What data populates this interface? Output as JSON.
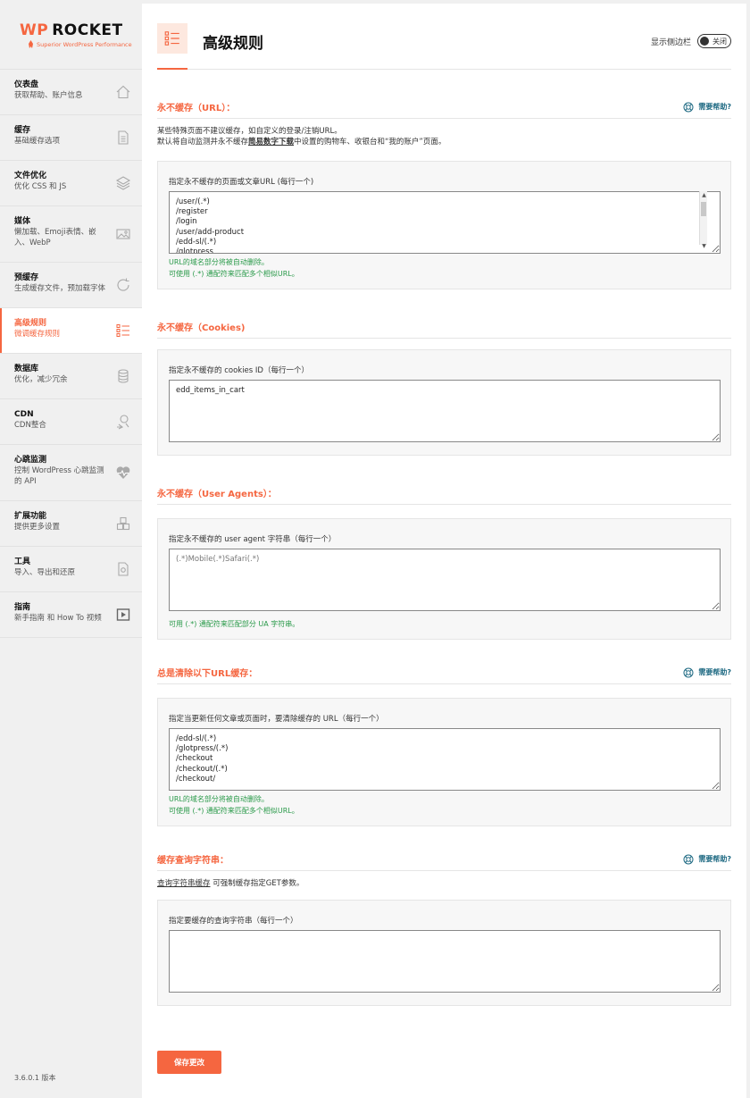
{
  "logo": {
    "brand_wp": "WP",
    "brand_rocket": "ROCKET",
    "tagline": "Superior WordPress Performance"
  },
  "sidebar": {
    "items": [
      {
        "title": "仪表盘",
        "desc": "获取帮助、账户信息",
        "icon": "home-icon"
      },
      {
        "title": "缓存",
        "desc": "基础缓存选项",
        "icon": "document-icon"
      },
      {
        "title": "文件优化",
        "desc": "优化 CSS 和 JS",
        "icon": "layers-icon"
      },
      {
        "title": "媒体",
        "desc": "懒加载、Emoji表情、嵌入、WebP",
        "icon": "image-icon"
      },
      {
        "title": "预缓存",
        "desc": "生成缓存文件，预加载字体",
        "icon": "refresh-icon"
      },
      {
        "title": "高级规则",
        "desc": "微调缓存规则",
        "icon": "list-icon"
      },
      {
        "title": "数据库",
        "desc": "优化，减少冗余",
        "icon": "database-icon"
      },
      {
        "title": "CDN",
        "desc": "CDN整合",
        "icon": "cdn-icon"
      },
      {
        "title": "心跳监测",
        "desc": "控制 WordPress 心跳监测的 API",
        "icon": "heartbeat-icon"
      },
      {
        "title": "扩展功能",
        "desc": "提供更多设置",
        "icon": "addons-icon"
      },
      {
        "title": "工具",
        "desc": "导入、导出和还原",
        "icon": "tools-icon"
      },
      {
        "title": "指南",
        "desc": "新手指南 和 How To 视频",
        "icon": "play-icon"
      }
    ],
    "version": "3.6.0.1 版本"
  },
  "header": {
    "title": "高级规则",
    "toggle_label": "显示侧边栏",
    "toggle_state": "关闭"
  },
  "help_label": "需要帮助?",
  "sections": {
    "never_cache_url": {
      "title": "永不缓存（URL）：",
      "desc_line1": "某些特殊页面不建议缓存，如自定义的登录/注销URL。",
      "desc_line2_pre": "默认将自动监测并永不缓存",
      "desc_line2_link": "简易数字下载",
      "desc_line2_post": "中设置的购物车、收银台和“我的账户”页面。",
      "field_label": "指定永不缓存的页面或文章URL (每行一个)",
      "value": "/user/(.*)\n/register\n/login\n/user/add-product\n/edd-sl/(.*)\n/glotpress",
      "hint1": "URL的域名部分将被自动删除。",
      "hint2": "可使用 (.*) 通配符来匹配多个相似URL。"
    },
    "never_cache_cookies": {
      "title": "永不缓存（Cookies)",
      "field_label": "指定永不缓存的 cookies ID（每行一个）",
      "value": "edd_items_in_cart"
    },
    "never_cache_ua": {
      "title": "永不缓存（User Agents）：",
      "field_label": "指定永不缓存的 user agent 字符串（每行一个）",
      "placeholder": "(.*)Mobile(.*)Safari(.*)",
      "hint": "可用 (.*) 通配符来匹配部分 UA 字符串。"
    },
    "always_purge": {
      "title": "总是清除以下URL缓存：",
      "field_label": "指定当更新任何文章或页面时，要清除缓存的 URL（每行一个）",
      "value": "/edd-sl/(.*)\n/glotpress/(.*)\n/checkout\n/checkout/(.*)\n/checkout/",
      "hint1": "URL的域名部分将被自动删除。",
      "hint2": "可使用 (.*) 通配符来匹配多个相似URL。"
    },
    "query_strings": {
      "title": "缓存查询字符串：",
      "desc_link": "查询字符串缓存",
      "desc_post": " 可强制缓存指定GET参数。",
      "field_label": "指定要缓存的查询字符串（每行一个）",
      "value": ""
    }
  },
  "save_button": "保存更改",
  "colors": {
    "accent": "#f56640",
    "hint_green": "#2a9a4a",
    "help_blue": "#1f6a83"
  }
}
